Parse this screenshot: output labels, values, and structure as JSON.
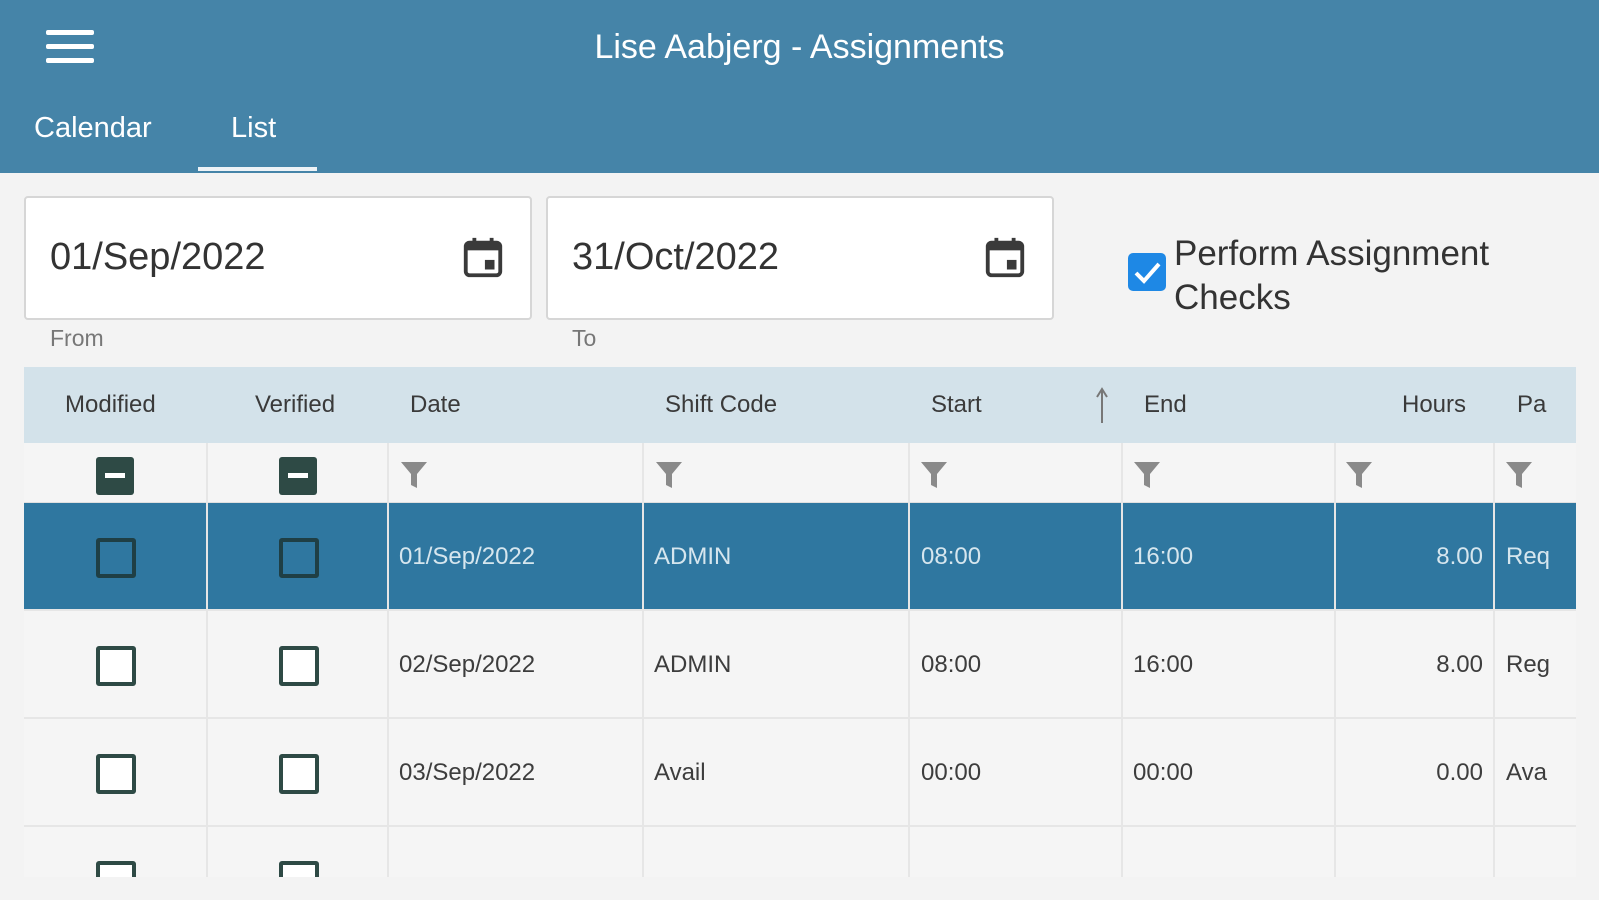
{
  "header": {
    "title": "Lise Aabjerg - Assignments",
    "tabs": [
      {
        "label": "Calendar",
        "active": false
      },
      {
        "label": "List",
        "active": true
      }
    ]
  },
  "filters": {
    "from": {
      "value": "01/Sep/2022",
      "label": "From"
    },
    "to": {
      "value": "31/Oct/2022",
      "label": "To"
    },
    "perform_checks": {
      "label": "Perform Assignment Checks",
      "checked": true
    }
  },
  "grid": {
    "columns": [
      "Modified",
      "Verified",
      "Date",
      "Shift Code",
      "Start",
      "End",
      "Hours",
      "Pa"
    ],
    "sort": {
      "column": "Start",
      "direction": "ascending"
    },
    "rows": [
      {
        "date": "01/Sep/2022",
        "shift": "ADMIN",
        "start": "08:00",
        "end": "16:00",
        "hours": "8.00",
        "pay": "Req",
        "modified": false,
        "verified": false,
        "selected": true
      },
      {
        "date": "02/Sep/2022",
        "shift": "ADMIN",
        "start": "08:00",
        "end": "16:00",
        "hours": "8.00",
        "pay": "Reg",
        "modified": false,
        "verified": false,
        "selected": false
      },
      {
        "date": "03/Sep/2022",
        "shift": "Avail",
        "start": "00:00",
        "end": "00:00",
        "hours": "0.00",
        "pay": "Ava",
        "modified": false,
        "verified": false,
        "selected": false
      }
    ]
  },
  "colors": {
    "appbar": "#4584a8",
    "selected_row": "#2f77a0",
    "header_row": "#d3e2ea",
    "checkbox_accent": "#1e88e5"
  },
  "icons": [
    "menu-icon",
    "calendar-icon",
    "filter-icon",
    "sort-arrow-icon",
    "check-icon"
  ]
}
